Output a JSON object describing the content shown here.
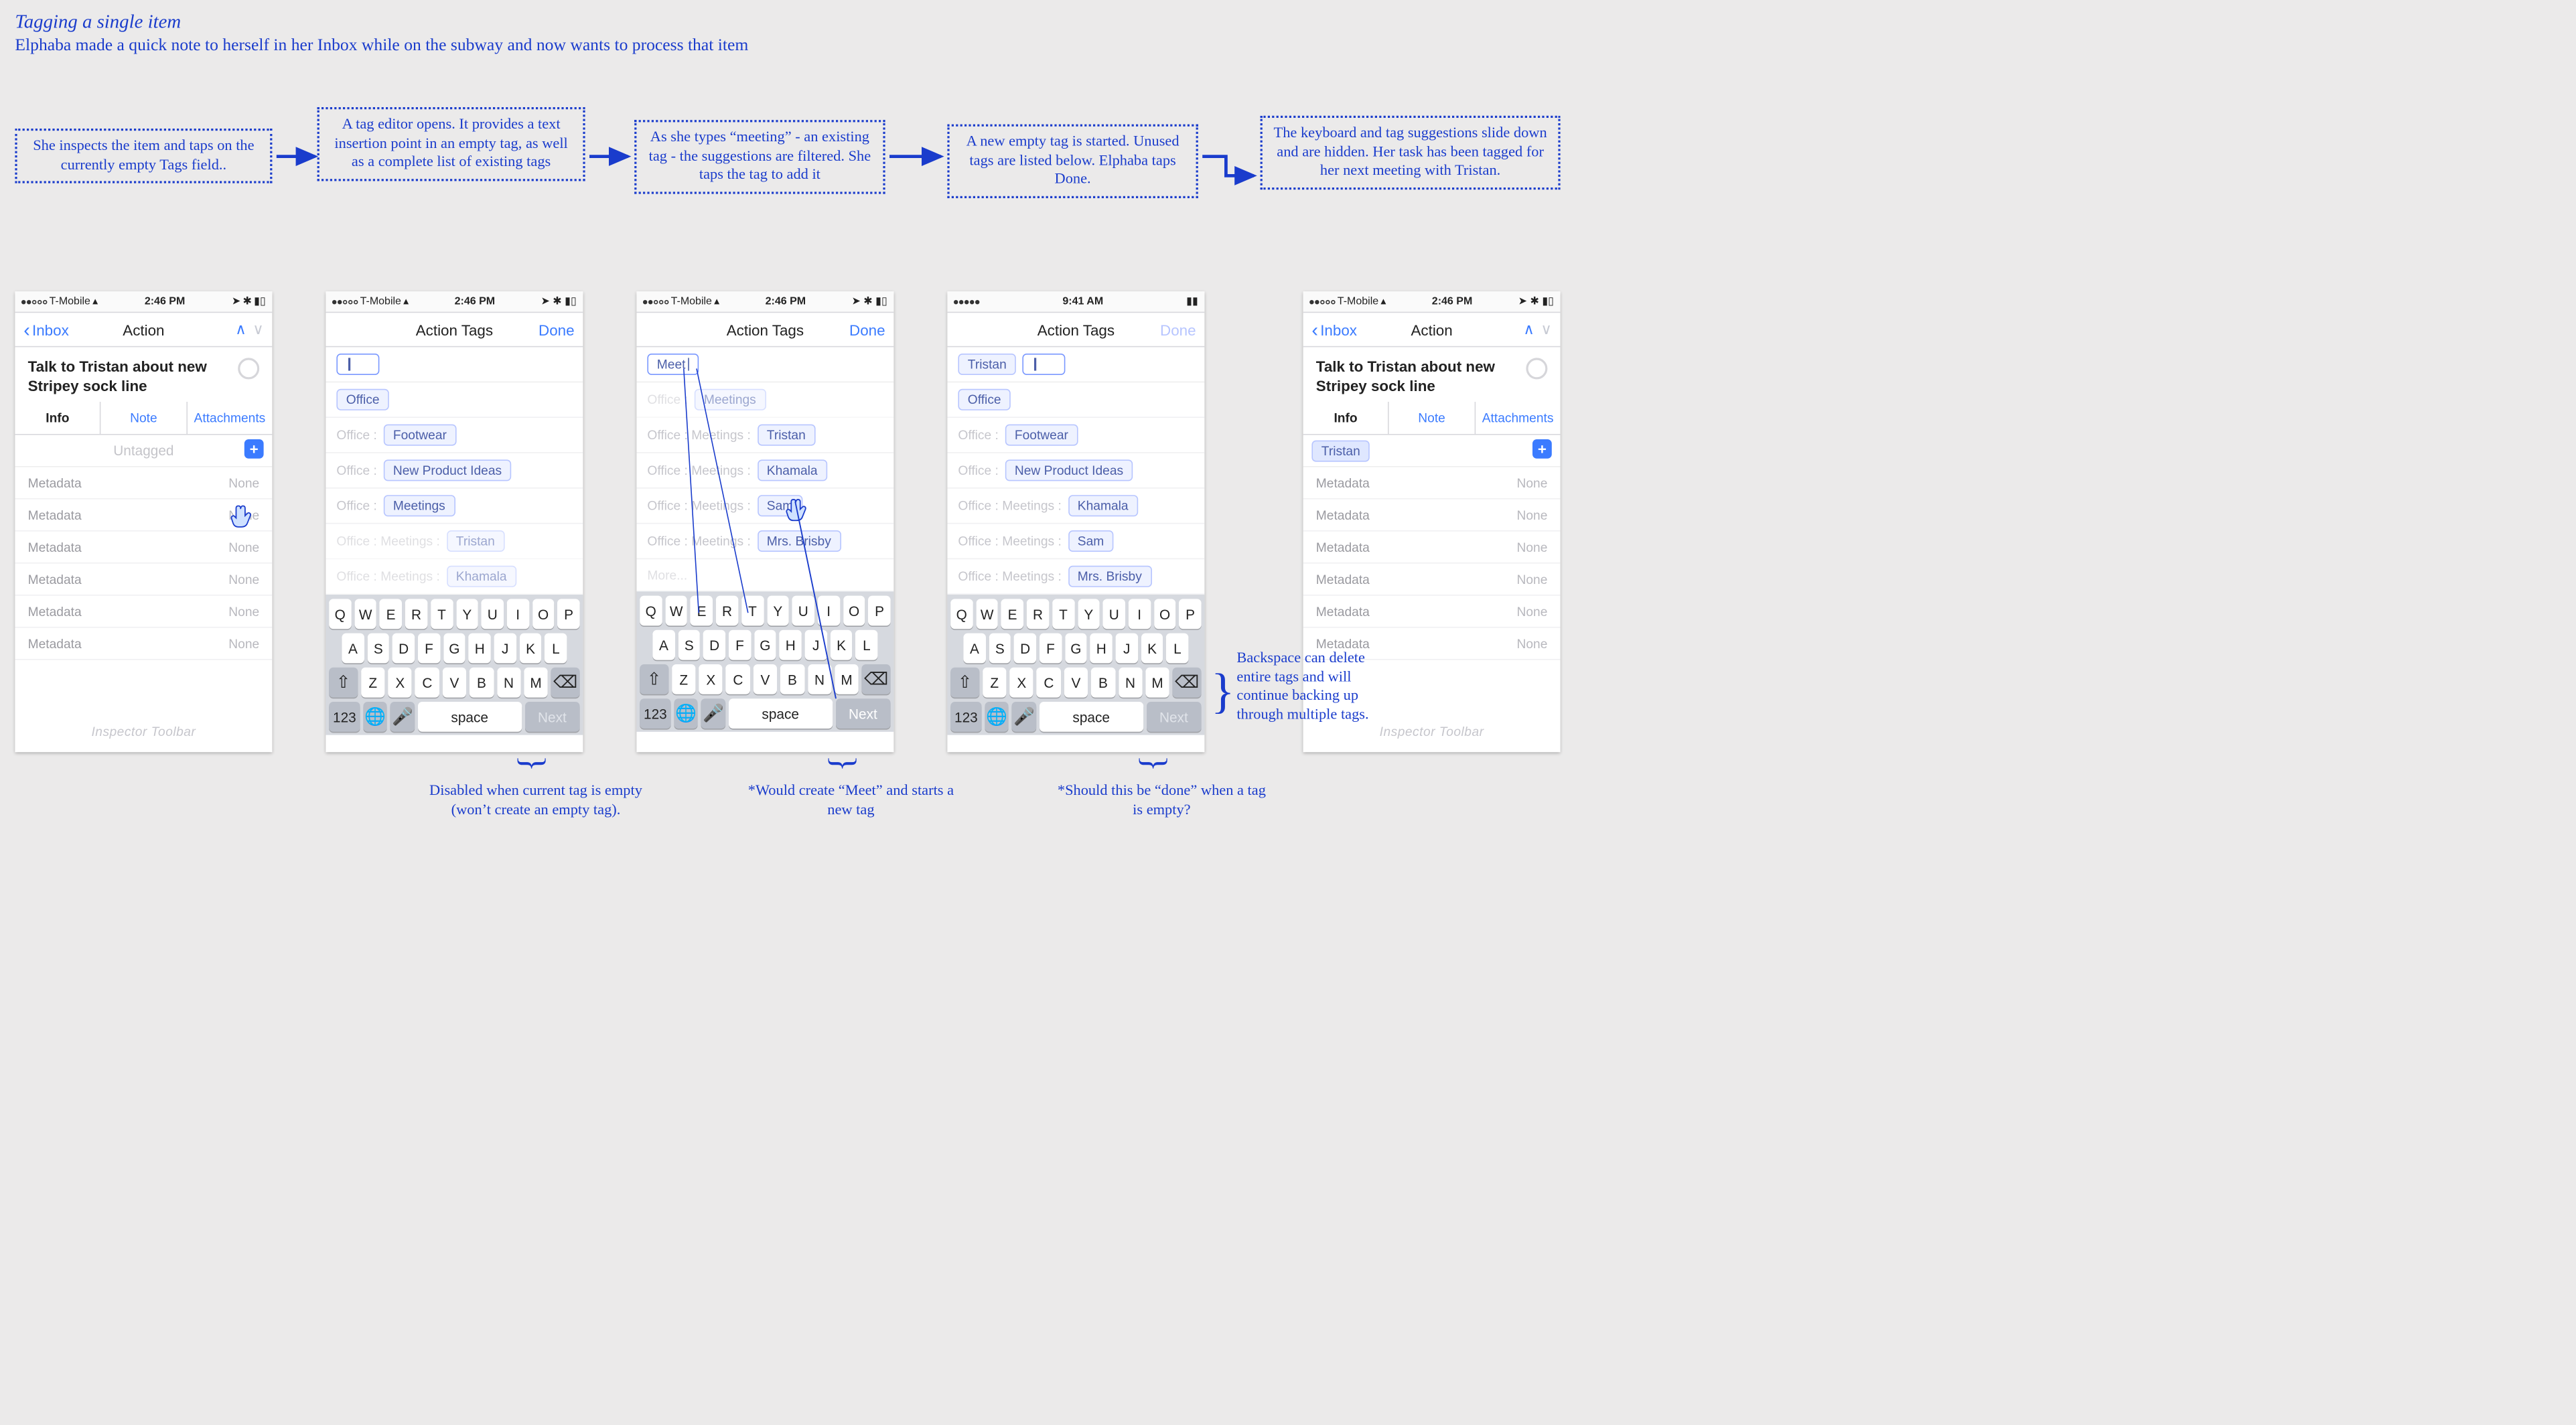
{
  "title": "Tagging a single item",
  "subtitle": "Elphaba made a quick note to herself in her Inbox while on the subway and now wants to process that item",
  "annotations": {
    "step1": "She inspects the item and taps on the currently empty Tags field..",
    "step2": "A tag editor opens. It provides a text insertion point in an empty tag, as well as a complete list of existing tags",
    "step3": "As she types “meeting” - an existing tag - the suggestions are filtered. She taps the tag to add it",
    "step4": "A new empty tag is started. Unused tags are listed below. Elphaba taps Done.",
    "step5": "The keyboard and tag suggestions slide down and are hidden.  Her task has been tagged for her next meeting with Tristan."
  },
  "notes": {
    "n1": "Disabled when current tag is empty (won’t create an empty tag).",
    "n2": "*Would create “Meet” and starts a new tag",
    "n3": "*Should this be “done” when a tag is empty?",
    "n4": "Backspace can delete entire tags and will continue backing up through multiple tags."
  },
  "status": {
    "carrier": "T-Mobile",
    "time1": "2:46 PM",
    "time2": "9:41 AM"
  },
  "common": {
    "inbox": "Inbox",
    "action": "Action",
    "actionTags": "Action Tags",
    "done": "Done",
    "untagged": "Untagged",
    "metadata": "Metadata",
    "none": "None",
    "toolbar": "Inspector Toolbar",
    "tabs": {
      "info": "Info",
      "note": "Note",
      "attachments": "Attachments"
    },
    "taskTitle": "Talk to Tristan about new Stripey sock line"
  },
  "screen2": {
    "input": "",
    "rows": [
      {
        "path": "",
        "suffix": "Office"
      },
      {
        "path": "Office :",
        "suffix": "Footwear"
      },
      {
        "path": "Office :",
        "suffix": "New Product Ideas"
      },
      {
        "path": "Office :",
        "suffix": "Meetings"
      },
      {
        "path": "Office : Meetings :",
        "suffix": "Tristan",
        "dim": true
      },
      {
        "path": "Office : Meetings :",
        "suffix": "Khamala",
        "dim": true
      }
    ]
  },
  "screen3": {
    "input": "Meet",
    "rows": [
      {
        "path": "Office :",
        "suffix": "Meetings",
        "dim": true
      },
      {
        "path": "Office : Meetings :",
        "suffix": "Tristan"
      },
      {
        "path": "Office : Meetings :",
        "suffix": "Khamala"
      },
      {
        "path": "Office : Meetings :",
        "suffix": "Sam"
      },
      {
        "path": "Office : Meetings :",
        "suffix": "Mrs. Brisby"
      },
      {
        "path": "More...",
        "suffix": "",
        "dim": true
      }
    ]
  },
  "screen4": {
    "chip": "Tristan",
    "input": "",
    "rows": [
      {
        "path": "",
        "suffix": "Office"
      },
      {
        "path": "Office :",
        "suffix": "Footwear"
      },
      {
        "path": "Office :",
        "suffix": "New Product Ideas"
      },
      {
        "path": "Office : Meetings :",
        "suffix": "Khamala"
      },
      {
        "path": "Office : Meetings :",
        "suffix": "Sam"
      },
      {
        "path": "Office : Meetings :",
        "suffix": "Mrs. Brisby"
      }
    ]
  },
  "screen5": {
    "chip": "Tristan"
  },
  "kbd": {
    "space": "space",
    "next": "Next",
    "num": "123"
  }
}
